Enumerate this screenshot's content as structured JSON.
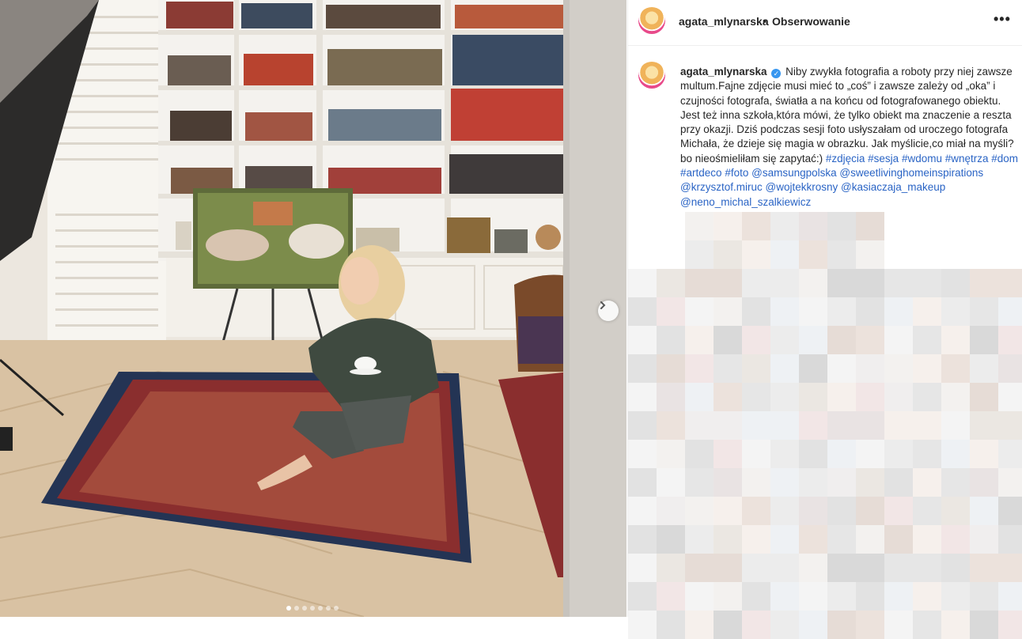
{
  "post": {
    "username": "agata_mlynarska",
    "separator": "•",
    "follow_label": "Obserwowanie",
    "more_label": "•••",
    "verified": "✓"
  },
  "caption": {
    "text": "Niby zwykła fotografia a roboty przy niej zawsze multum.Fajne zdjęcie musi mieć to „coś” i zawsze zależy od „oka” i czujności fotografa, światła a na końcu od fotografowanego obiektu. Jest też inna szkoła,która mówi, że tylko obiekt ma znaczenie a reszta przy okazji. Dziś podczas sesji foto usłyszałam od uroczego fotografa Michała, że dzieje się magia w obrazku. Jak myślicie,co miał na myśli? bo nieośmieliłam się zapytać:)",
    "tags": [
      "#zdjęcia",
      "#sesja",
      "#wdomu",
      "#wnętrza",
      "#dom",
      "#artdeco",
      "#foto",
      "@samsungpolska",
      "@sweetlivinghomeinspirations",
      "@krzysztof.miruc",
      "@wojtekkrosny",
      "@kasiaczaja_makeup",
      "@neno_michal_szalkiewicz"
    ]
  },
  "carousel": {
    "total": 7,
    "current": 1
  },
  "colors": {
    "link": "#2a64c5",
    "verified": "#3897f0",
    "border": "#efefef"
  },
  "icons": {
    "next": "chevron-right-icon",
    "more": "more-horizontal-icon"
  }
}
